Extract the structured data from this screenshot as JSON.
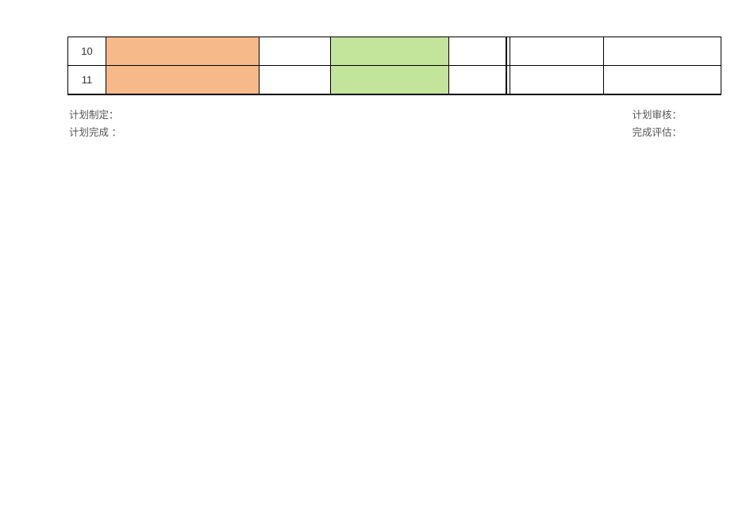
{
  "table": {
    "rows": [
      {
        "num": "10"
      },
      {
        "num": "11"
      }
    ]
  },
  "labels": {
    "plan_create": "计划制定：",
    "plan_review": "计划审核：",
    "plan_complete": "计划完成 ：",
    "complete_eval": "完成评估："
  }
}
